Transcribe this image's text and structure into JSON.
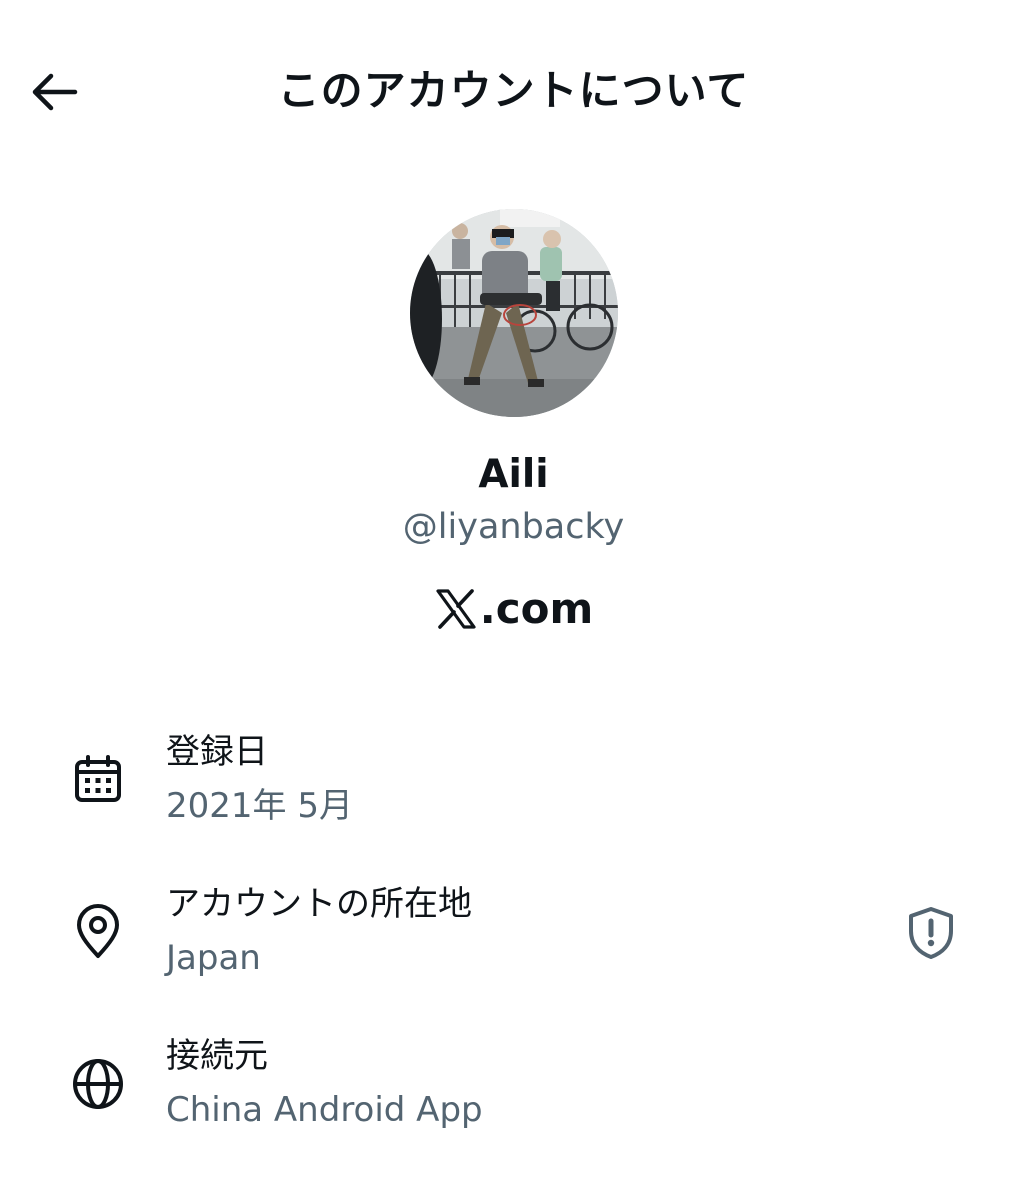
{
  "header": {
    "title": "このアカウントについて",
    "back_icon": "arrow-left-icon"
  },
  "profile": {
    "display_name": "Aili",
    "handle": "@liyanbacky",
    "brand_suffix": ".com",
    "brand_icon": "x-logo-icon"
  },
  "details": {
    "joined": {
      "label": "登録日",
      "value": "2021年 5月",
      "icon": "calendar-icon"
    },
    "location": {
      "label": "アカウントの所在地",
      "value": "Japan",
      "icon": "location-pin-icon",
      "action_icon": "shield-alert-icon"
    },
    "connected_via": {
      "label": "接続元",
      "value": "China Android App",
      "icon": "globe-icon"
    }
  },
  "colors": {
    "text_primary": "#0f1419",
    "text_secondary": "#536471"
  }
}
